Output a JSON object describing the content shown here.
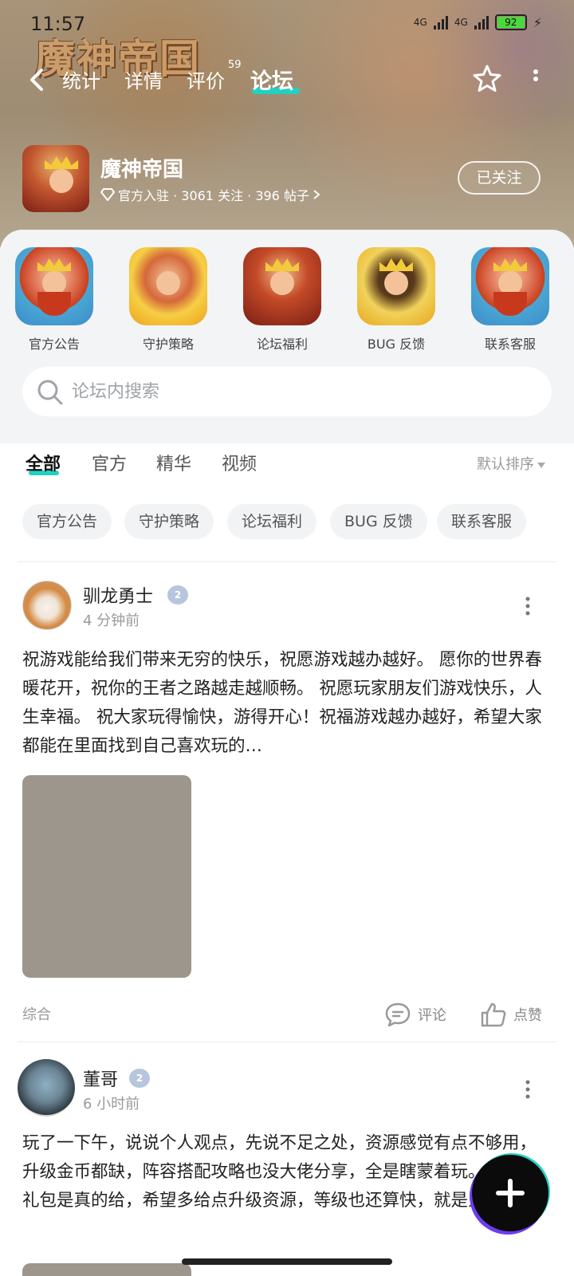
{
  "status": {
    "time": "11:57",
    "net1": "4G",
    "net2": "4G",
    "battery": "92"
  },
  "banner": {
    "logo_text": "魔神帝国"
  },
  "nav": {
    "tabs": [
      {
        "label": "统计"
      },
      {
        "label": "详情"
      },
      {
        "label": "评价",
        "badge": "59"
      },
      {
        "label": "论坛"
      }
    ],
    "active_tab": "论坛"
  },
  "game": {
    "name": "魔神帝国",
    "meta": "官方入驻 · 3061 关注 · 396 帖子",
    "follow_label": "已关注"
  },
  "shortcuts": [
    {
      "label": "官方公告",
      "icon": "king-portrait-icon"
    },
    {
      "label": "守护策略",
      "icon": "warrior-portrait-icon"
    },
    {
      "label": "论坛福利",
      "icon": "game-hero-icon"
    },
    {
      "label": "BUG 反馈",
      "icon": "general-portrait-icon"
    },
    {
      "label": "联系客服",
      "icon": "king-portrait-icon"
    }
  ],
  "search": {
    "placeholder": "论坛内搜索"
  },
  "filter_tabs": [
    "全部",
    "官方",
    "精华",
    "视频"
  ],
  "active_filter": "全部",
  "sort_label": "默认排序",
  "chips": [
    "官方公告",
    "守护策略",
    "论坛福利",
    "BUG 反馈",
    "联系客服"
  ],
  "posts": [
    {
      "author": "驯龙勇士",
      "level": "2",
      "time": "4 分钟前",
      "body": "祝游戏能给我们带来无穷的快乐，祝愿游戏越办越好。 愿你的世界春暖花开，祝你的王者之路越走越顺畅。 祝愿玩家朋友们游戏快乐，人生幸福。 祝大家玩得愉快，游得开心！祝福游戏越办越好，希望大家都能在里面找到自己喜欢玩的…",
      "category": "综合",
      "comment_label": "评论",
      "like_label": "点赞"
    },
    {
      "author": "董哥",
      "level": "2",
      "time": "6 小时前",
      "body": "玩了一下午，说说个人观点，先说不足之处，资源感觉有点不够用，升级金币都缺，阵容搭配攻略也没大佬分享，全是瞎蒙着玩。优点，礼包是真的给，希望多给点升级资源，等级也还算快，就是人太少，应该是宣传还不够。"
    }
  ],
  "colors": {
    "accent": "#22d1c2",
    "panel_bg": "#f3f4f6",
    "chip_bg": "#f2f3f5"
  }
}
